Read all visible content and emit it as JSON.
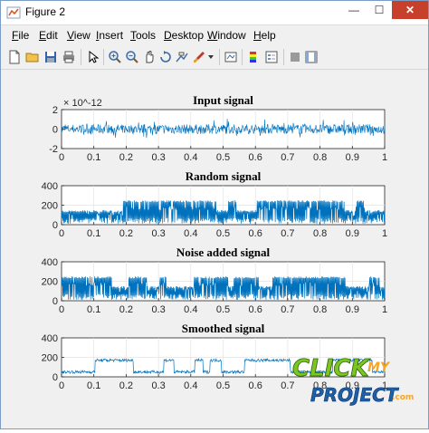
{
  "window": {
    "title": "Figure 2",
    "minimize": "—",
    "maximize": "☐",
    "close": "✕"
  },
  "menu": [
    {
      "label": "File",
      "key": "F"
    },
    {
      "label": "Edit",
      "key": "E"
    },
    {
      "label": "View",
      "key": "V"
    },
    {
      "label": "Insert",
      "key": "I"
    },
    {
      "label": "Tools",
      "key": "T"
    },
    {
      "label": "Desktop",
      "key": "D"
    },
    {
      "label": "Window",
      "key": "W"
    },
    {
      "label": "Help",
      "key": "H"
    }
  ],
  "toolbar": {
    "icons": [
      "new-figure-icon",
      "open-file-icon",
      "save-icon",
      "print-icon",
      "select-arrow-icon",
      "zoom-in-icon",
      "zoom-out-icon",
      "pan-icon",
      "rotate-3d-icon",
      "data-cursor-icon",
      "brush-icon",
      "link-plot-icon",
      "colorbar-icon",
      "legend-icon",
      "hide-plot-tools-icon",
      "show-plot-tools-icon"
    ]
  },
  "logo": {
    "line1": "CLICK",
    "line2": "MY",
    "line3": "PROJECT",
    "suffix": ".com",
    "colors": {
      "green": "#7cc623",
      "blue": "#1d5fa8",
      "orange": "#f5a623"
    }
  },
  "colors": {
    "line": "#0072bd",
    "axes_bg": "#ffffff",
    "figure_bg": "#f0f0f0",
    "close_button": "#c7402b"
  },
  "chart_data": [
    {
      "type": "line",
      "title": "Input signal",
      "exponent_label": "× 10^-12",
      "x_ticks": [
        "0",
        "0.1",
        "0.2",
        "0.3",
        "0.4",
        "0.5",
        "0.6",
        "0.7",
        "0.8",
        "0.9",
        "1"
      ],
      "y_ticks": [
        "-2",
        "0",
        "2"
      ],
      "xlim": [
        0,
        1
      ],
      "ylim": [
        -2,
        2
      ],
      "grid": true,
      "series": [
        {
          "x_range": [
            0,
            1
          ],
          "amplitude": 0.6,
          "offset": 0
        }
      ]
    },
    {
      "type": "line",
      "title": "Random signal",
      "x_ticks": [
        "0",
        "0.1",
        "0.2",
        "0.3",
        "0.4",
        "0.5",
        "0.6",
        "0.7",
        "0.8",
        "0.9",
        "1"
      ],
      "y_ticks": [
        "0",
        "200",
        "400"
      ],
      "xlim": [
        0,
        1
      ],
      "ylim": [
        0,
        400
      ],
      "grid": true,
      "series": [
        {
          "x_range": [
            0,
            1
          ],
          "low_level": 150,
          "high_level": 250,
          "min": 0
        }
      ]
    },
    {
      "type": "line",
      "title": "Noise added signal",
      "x_ticks": [
        "0",
        "0.1",
        "0.2",
        "0.3",
        "0.4",
        "0.5",
        "0.6",
        "0.7",
        "0.8",
        "0.9",
        "1"
      ],
      "y_ticks": [
        "0",
        "200",
        "400"
      ],
      "xlim": [
        0,
        1
      ],
      "ylim": [
        0,
        400
      ],
      "grid": true,
      "series": [
        {
          "x_range": [
            0,
            1
          ],
          "low_level": 150,
          "high_level": 250,
          "min": 0
        }
      ]
    },
    {
      "type": "line",
      "title": "Smoothed signal",
      "x_ticks": [
        "0",
        "0.1",
        "0.2",
        "0.3",
        "0.4",
        "0.5",
        "0.6",
        "0.7",
        "0.8",
        "0.9",
        "1"
      ],
      "y_ticks": [
        "0",
        "200",
        "400"
      ],
      "xlim": [
        0,
        1
      ],
      "ylim": [
        0,
        400
      ],
      "grid": true,
      "series": [
        {
          "x_range": [
            0,
            1
          ],
          "low_level": 50,
          "high_level": 170,
          "min": 0
        }
      ]
    }
  ]
}
